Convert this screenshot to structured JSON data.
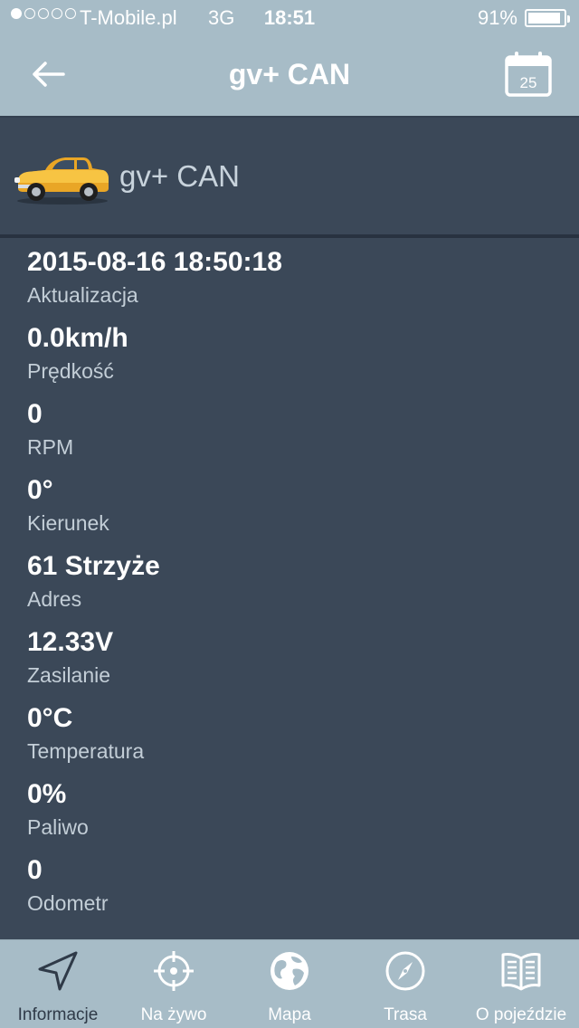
{
  "status_bar": {
    "carrier": "T-Mobile.pl",
    "network": "3G",
    "time": "18:51",
    "battery_percent": "91%",
    "battery_level": 0.91,
    "signal_bars": 1
  },
  "nav": {
    "title": "gv+ CAN",
    "back_icon": "arrow-left-icon",
    "calendar_icon": "calendar-icon",
    "calendar_day": "25"
  },
  "vehicle": {
    "name": "gv+ CAN",
    "image": "car-icon"
  },
  "fields": [
    {
      "value": "2015-08-16 18:50:18",
      "label": "Aktualizacja"
    },
    {
      "value": "0.0km/h",
      "label": "Prędkość"
    },
    {
      "value": "0",
      "label": "RPM"
    },
    {
      "value": "0°",
      "label": "Kierunek"
    },
    {
      "value": "61 Strzyże",
      "label": "Adres"
    },
    {
      "value": "12.33V",
      "label": "Zasilanie"
    },
    {
      "value": "0°C",
      "label": "Temperatura"
    },
    {
      "value": "0%",
      "label": "Paliwo"
    },
    {
      "value": "0",
      "label": "Odometr"
    }
  ],
  "tabs": [
    {
      "label": "Informacje",
      "icon": "navigation-arrow-icon",
      "active": true
    },
    {
      "label": "Na żywo",
      "icon": "crosshair-icon",
      "active": false
    },
    {
      "label": "Mapa",
      "icon": "globe-icon",
      "active": false
    },
    {
      "label": "Trasa",
      "icon": "compass-icon",
      "active": false
    },
    {
      "label": "O pojeździe",
      "icon": "book-icon",
      "active": false
    }
  ],
  "colors": {
    "bar": "#a7bcc7",
    "background": "#3b4858",
    "text_primary": "#ffffff",
    "text_secondary": "#c3ced7",
    "active_tab": "#2f3a48"
  }
}
